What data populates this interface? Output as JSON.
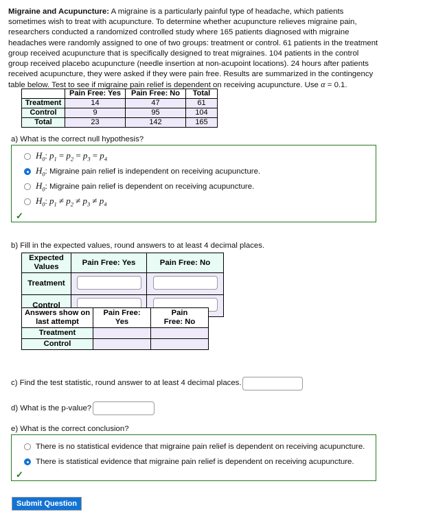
{
  "intro": {
    "title": "Migraine and Acupuncture:",
    "body": " A migraine is a particularly painful type of headache, which patients sometimes wish to treat with acupuncture. To determine whether acupuncture relieves migraine pain, researchers conducted a randomized controlled study where 165 patients diagnosed with migraine headaches were randomly assigned to one of two groups: treatment or control. 61 patients in the treatment group received acupuncture that is specifically designed to treat migraines. 104 patients in the control group received placebo acupuncture (needle insertion at non-acupoint locations). 24 hours after patients received acupuncture, they were asked if they were pain free. Results are summarized in the contingency table below. Test to see if migraine pain relief is dependent on receiving acupuncture. Use ",
    "alpha_symbol": "α",
    "alpha_equals": " = ",
    "alpha_value": "0.1."
  },
  "contingency_table": {
    "corner": "",
    "columns": [
      "Pain Free: Yes",
      "Pain Free: No",
      "Total"
    ],
    "rows": [
      {
        "label": "Treatment",
        "values": [
          "14",
          "47",
          "61"
        ]
      },
      {
        "label": "Control",
        "values": [
          "9",
          "95",
          "104"
        ]
      },
      {
        "label": "Total",
        "values": [
          "23",
          "142",
          "165"
        ]
      }
    ]
  },
  "question_a": {
    "prompt": "a) What is the correct null hypothesis?",
    "options": [
      {
        "text_html": "<span class=\"mj\">H<sub>0</sub></span>:&nbsp;<span class=\"mj\">p<sub>1</sub></span> <span class=\"mj-eq\">=</span> <span class=\"mj\">p<sub>2</sub></span> <span class=\"mj-eq\">=</span> <span class=\"mj\">p<sub>3</sub></span> <span class=\"mj-eq\">=</span> <span class=\"mj\">p<sub>4</sub></span>",
        "selected": false
      },
      {
        "text_html": "<span class=\"mj\">H<sub>0</sub></span>: Migraine pain relief is independent on receiving acupuncture.",
        "selected": true
      },
      {
        "text_html": "<span class=\"mj\">H<sub>0</sub></span>: Migraine pain relief is dependent on receiving acupuncture.",
        "selected": false
      },
      {
        "text_html": "<span class=\"mj\">H<sub>0</sub></span>:&nbsp;<span class=\"mj\">p<sub>1</sub></span> <span class=\"mj-eq\">≠</span> <span class=\"mj\">p<sub>2</sub></span> <span class=\"mj-eq\">≠</span> <span class=\"mj\">p<sub>3</sub></span> <span class=\"mj-eq\">≠</span> <span class=\"mj\">p<sub>4</sub></span>",
        "selected": false
      }
    ],
    "check_mark": "✓"
  },
  "question_b": {
    "prompt": "b) Fill in the expected values, round answers to at least 4 decimal places.",
    "expected_table": {
      "corner_line1": "Expected",
      "corner_line2": "Values",
      "columns": [
        "Pain Free: Yes",
        "Pain Free: No"
      ],
      "rows": [
        {
          "label": "Treatment",
          "inputs": [
            "",
            ""
          ]
        },
        {
          "label": "Control",
          "inputs": [
            "",
            ""
          ]
        }
      ]
    },
    "last_attempt_table": {
      "corner_line1": "Answers show on",
      "corner_line2": "last attempt",
      "col1_line1": "Pain Free:",
      "col1_line2": "Yes",
      "col2_line1": "Pain",
      "col2_line2": "Free: No",
      "rows": [
        {
          "label": "Treatment",
          "values": [
            "",
            ""
          ]
        },
        {
          "label": "Control",
          "values": [
            "",
            ""
          ]
        }
      ]
    }
  },
  "question_c": {
    "prompt": "c) Find the test statistic, round answer to at least 4 decimal places.",
    "value": ""
  },
  "question_d": {
    "prompt": "d) What is the p-value?",
    "value": ""
  },
  "question_e": {
    "prompt": "e) What is the correct conclusion?",
    "options": [
      {
        "text": "There is no statistical evidence that migraine pain relief is dependent on receiving acupuncture.",
        "selected": false
      },
      {
        "text": "There is statistical evidence that migraine pain relief is dependent on receiving acupuncture.",
        "selected": true
      }
    ],
    "check_mark": "✓"
  },
  "submit": {
    "label": "Submit Question"
  },
  "colors": {
    "accent_blue": "#1273d4",
    "correct_green": "#1f7a1f",
    "header_mint": "#e8fbf4",
    "cell_lavender": "#eeeafa"
  }
}
